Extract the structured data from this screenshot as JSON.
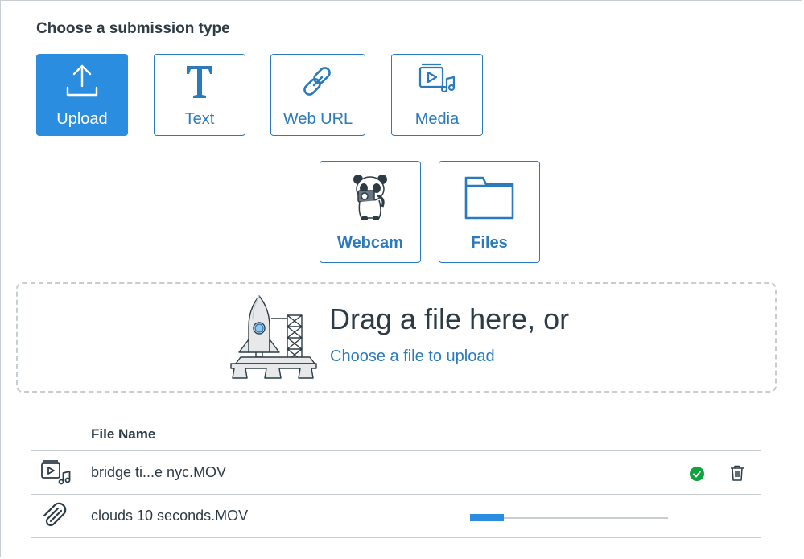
{
  "heading": "Choose a submission type",
  "submission_types": [
    {
      "label": "Upload",
      "icon": "upload-icon",
      "selected": true
    },
    {
      "label": "Text",
      "icon": "text-icon",
      "selected": false
    },
    {
      "label": "Web URL",
      "icon": "link-icon",
      "selected": false
    },
    {
      "label": "Media",
      "icon": "media-icon",
      "selected": false
    },
    {
      "label": "Webcam",
      "icon": "panda-webcam-icon",
      "selected": false
    },
    {
      "label": "Files",
      "icon": "folder-icon",
      "selected": false
    }
  ],
  "dropzone": {
    "title": "Drag a file here, or",
    "link": "Choose a file to upload",
    "illustration": "rocket-launch-illustration"
  },
  "file_table": {
    "header": "File Name",
    "rows": [
      {
        "name": "bridge ti...e nyc.MOV",
        "icon": "media-file-icon",
        "status": "complete",
        "status_icon": "check-circle-icon",
        "action_icon": "trash-icon"
      },
      {
        "name": "clouds 10 seconds.MOV",
        "icon": "paperclip-icon",
        "status": "uploading",
        "progress": 0.17
      }
    ]
  },
  "colors": {
    "accent": "#2b7abc",
    "selected_bg": "#2b8ddf",
    "success": "#0ea33c",
    "border": "#c7cdd1"
  }
}
